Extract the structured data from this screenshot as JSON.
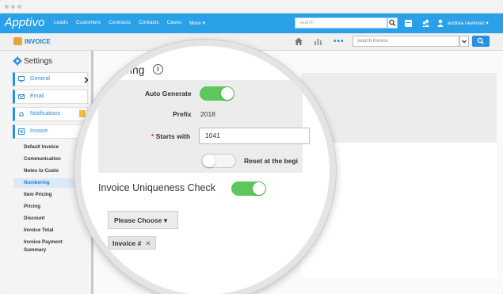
{
  "app": {
    "logo": "Apptivo",
    "module_title": "INVOICE"
  },
  "topnav": {
    "links": [
      "Leads",
      "Customers",
      "Contracts",
      "Contacts",
      "Cases",
      "More ▾"
    ],
    "search_placeholder": "search",
    "user": "andrea newman ▾"
  },
  "subbar": {
    "dots": "•••",
    "search_placeholder": "search Invoice"
  },
  "sidebar": {
    "title": "Settings",
    "items": [
      {
        "label": "General",
        "icon": "general-icon"
      },
      {
        "label": "Email",
        "icon": "envelope-icon"
      },
      {
        "label": "Notifications",
        "icon": "bell-icon"
      },
      {
        "label": "Invoice",
        "icon": "invoice-icon"
      }
    ],
    "subitems": [
      "Default Invoice",
      "Communication",
      "Notes to Custo",
      "Numbering",
      "Item Pricing",
      "Pricing",
      "Discount",
      "Invoice Total",
      "Invoice Payment",
      "Summary"
    ],
    "active_subitem": "Numbering"
  },
  "numbering": {
    "title": "mbering",
    "info_icon": "i",
    "auto_generate_label": "Auto Generate",
    "auto_generate_on": true,
    "prefix_label": "Prefix",
    "prefix_value": "2018",
    "required_mark": "*",
    "starts_with_label": "Starts with",
    "starts_with_value": "1041",
    "reset_label": "Reset at the begi",
    "reset_on": false
  },
  "uniqueness": {
    "title": "Invoice Uniqueness Check",
    "enabled": true,
    "choose_label": "Please Choose ▾",
    "chip_label": "Invoice #",
    "chip_remove": "✕"
  },
  "colors": {
    "brand": "#29a0e8",
    "toggle_on": "#5cc85c",
    "active_bg": "#dbe9f7"
  }
}
